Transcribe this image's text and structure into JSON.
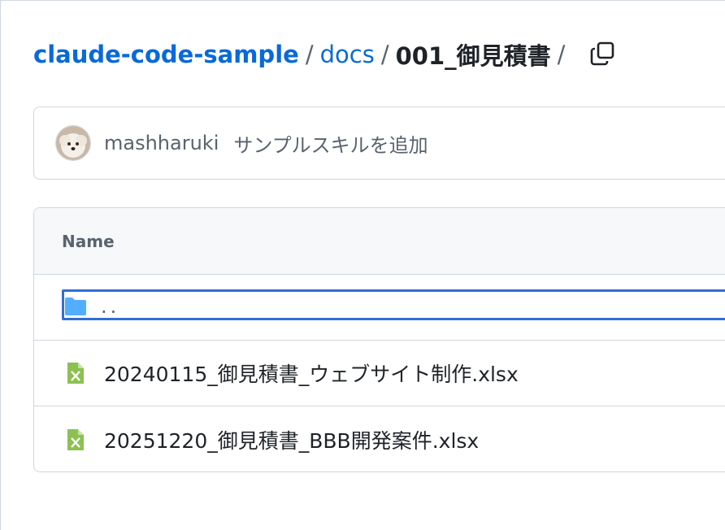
{
  "breadcrumb": {
    "repo": "claude-code-sample",
    "sep1": "/",
    "folder": "docs",
    "sep2": "/",
    "current": "001_御見積書",
    "sep3": "/"
  },
  "commit": {
    "author": "mashharuki",
    "message": "サンプルスキルを追加"
  },
  "table": {
    "header": "Name",
    "parent_row": "..",
    "files": [
      {
        "name": "20240115_御見積書_ウェブサイト制作.xlsx",
        "icon": "file-excel-icon"
      },
      {
        "name": "20251220_御見積書_BBB開発案件.xlsx",
        "icon": "file-excel-icon"
      }
    ]
  },
  "colors": {
    "link": "#0969da",
    "excel": "#8cc152",
    "folder": "#54aeff",
    "focus": "#2f6fd6"
  }
}
